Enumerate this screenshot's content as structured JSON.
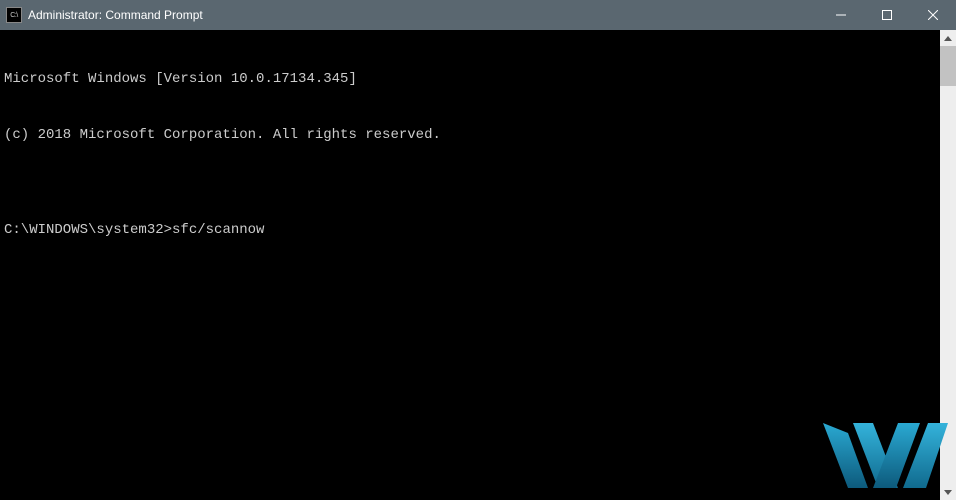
{
  "titlebar": {
    "icon_label": "C:\\",
    "title": "Administrator: Command Prompt"
  },
  "console": {
    "line1": "Microsoft Windows [Version 10.0.17134.345]",
    "line2": "(c) 2018 Microsoft Corporation. All rights reserved.",
    "blank": "",
    "prompt": "C:\\WINDOWS\\system32>",
    "command": "sfc/scannow"
  }
}
